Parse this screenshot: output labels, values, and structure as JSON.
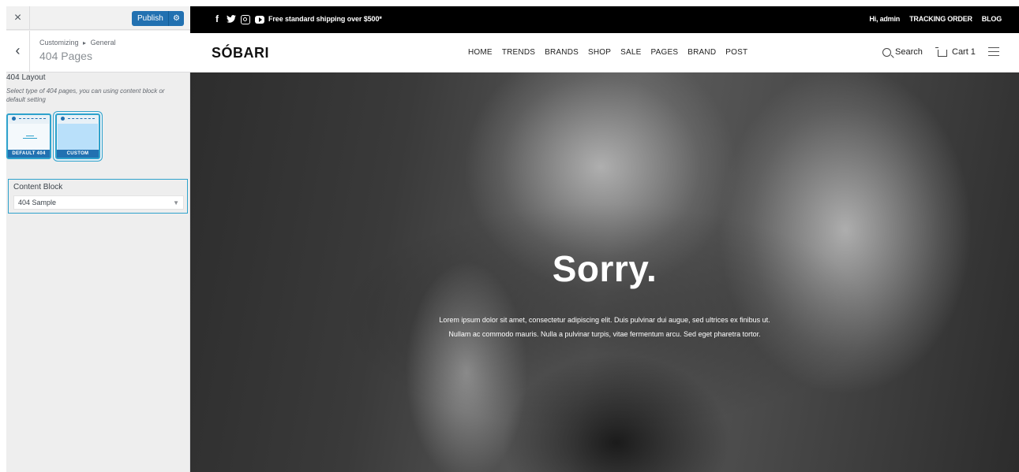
{
  "customizer": {
    "close_icon": "×",
    "publish_label": "Publish",
    "publish_gear_icon": "⚙",
    "back_icon": "‹",
    "breadcrumb_parent": "Customizing",
    "breadcrumb_sep": "▸",
    "breadcrumb_section": "General",
    "section_title": "404 Pages",
    "layout": {
      "title": "404 Layout",
      "description": "Select type of 404 pages, you can using content block or default setting",
      "options": [
        {
          "label": "DEFAULT 404",
          "selected": false
        },
        {
          "label": "CUSTOM",
          "selected": true
        }
      ]
    },
    "content_block": {
      "label": "Content Block",
      "value": "404 Sample",
      "caret": "▼"
    }
  },
  "site": {
    "topbar": {
      "social": [
        "facebook-icon",
        "twitter-icon",
        "instagram-icon",
        "youtube-icon"
      ],
      "facebook_glyph": "f",
      "twitter_glyph": "🐦",
      "shipping": "Free standard shipping over $500*",
      "greeting": "Hi, admin",
      "tracking": "TRACKING ORDER",
      "blog": "BLOG"
    },
    "logo": "SÓBARI",
    "menu": [
      "HOME",
      "TRENDS",
      "BRANDS",
      "SHOP",
      "SALE",
      "PAGES",
      "BRAND",
      "POST"
    ],
    "search_label": "Search",
    "cart_label": "Cart",
    "cart_count": "1",
    "hero": {
      "heading": "Sorry.",
      "text": "Lorem ipsum dolor sit amet, consectetur adipiscing elit. Duis pulvinar dui augue, sed ultrices ex finibus ut. Nullam ac commodo mauris. Nulla a pulvinar turpis, vitae fermentum arcu. Sed eget pharetra tortor."
    },
    "colors": {
      "accent": "#2271b1",
      "highlight": "#2ea2cc",
      "topbar": "#000000"
    }
  }
}
